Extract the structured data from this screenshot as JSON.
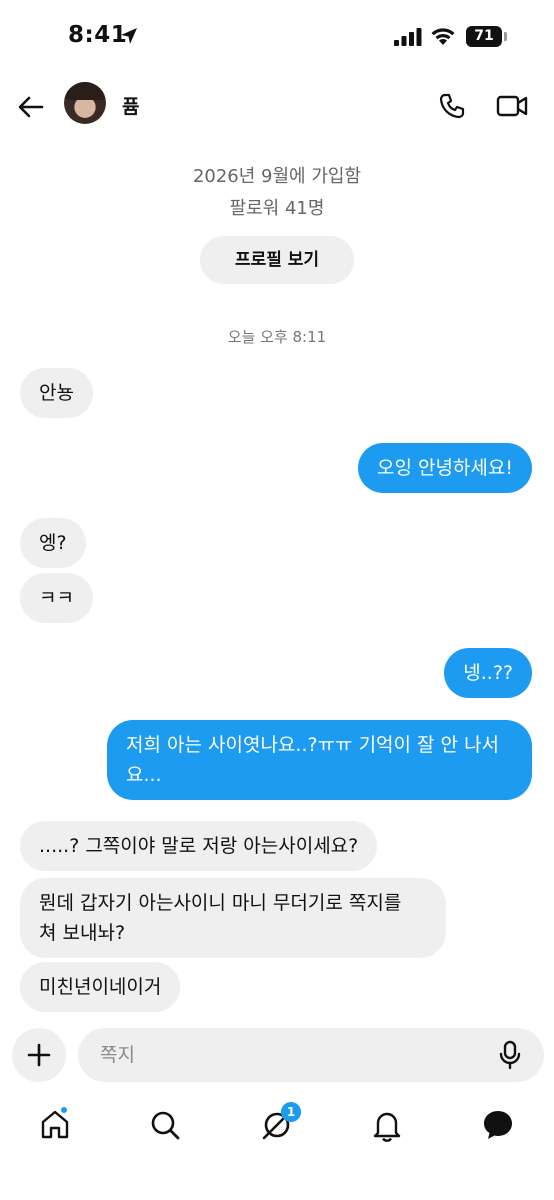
{
  "status_bar": {
    "time": "8:41",
    "battery": "71",
    "battery_level": 0.71
  },
  "header": {
    "contact_name": "퓸"
  },
  "intro": {
    "joined": "2026년 9월에 가입함",
    "followers": "팔로워 41명",
    "profile_button": "프로필 보기"
  },
  "timestamp": "오늘 오후 8:11",
  "messages": [
    {
      "direction": "in",
      "lines": [
        "안뇽"
      ]
    },
    {
      "direction": "out",
      "lines": [
        "오잉 안녕하세요!"
      ]
    },
    {
      "direction": "in",
      "lines": [
        "엥?"
      ]
    },
    {
      "direction": "in",
      "lines": [
        "ㅋㅋ"
      ]
    },
    {
      "direction": "out",
      "lines": [
        "넹..??"
      ]
    },
    {
      "direction": "out",
      "lines": [
        "저희 아는 사이엿나요..?ㅠㅠ 기억이 잘 안 나서",
        "요..."
      ]
    },
    {
      "direction": "in",
      "lines": [
        ".....? 그쪽이야 말로 저랑 아는사이세요?"
      ]
    },
    {
      "direction": "in",
      "lines": [
        "뭔데 갑자기 아는사이니 마니 무더기로 쪽지를",
        "쳐 보내놔?"
      ]
    },
    {
      "direction": "in",
      "lines": [
        "미친년이네이거"
      ]
    }
  ],
  "composer": {
    "placeholder": "쪽지"
  },
  "nav": {
    "messages_badge": "1"
  },
  "colors": {
    "accent": "#1d9bf0",
    "bubble_in": "#efefef"
  }
}
